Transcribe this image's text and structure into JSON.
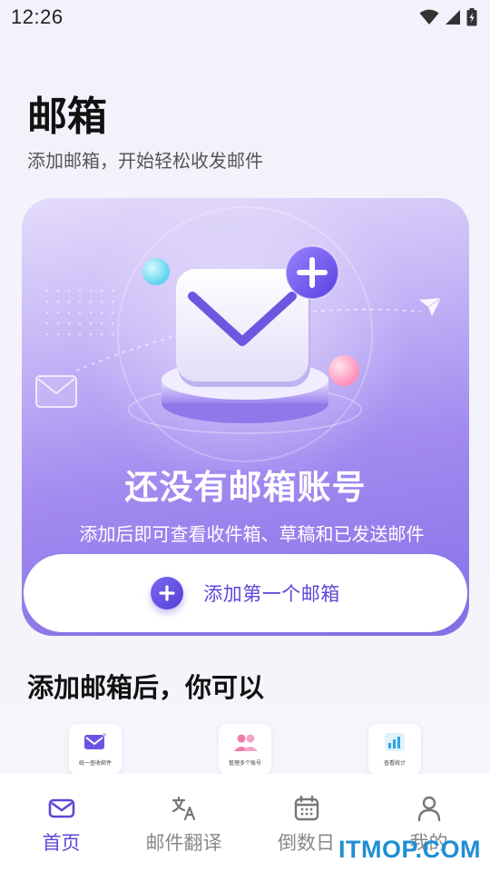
{
  "status_bar": {
    "time": "12:26",
    "icons": [
      "wifi-icon",
      "signal-icon",
      "battery-icon"
    ]
  },
  "page": {
    "title": "邮箱",
    "subtitle": "添加邮箱，开始轻松收发邮件"
  },
  "hero": {
    "heading": "还没有邮箱账号",
    "description": "添加后即可查看收件箱、草稿和已发送邮件",
    "add_button_label": "添加第一个邮箱"
  },
  "features": {
    "title": "添加邮箱后，你可以",
    "items": [
      {
        "label": "统一查收邮件",
        "icon": "envelope-icon"
      },
      {
        "label": "管理多个账号",
        "icon": "users-icon"
      },
      {
        "label": "查看统计",
        "icon": "bar-chart-icon"
      }
    ]
  },
  "tab_bar": {
    "items": [
      {
        "label": "首页",
        "icon": "mail-icon",
        "active": true
      },
      {
        "label": "邮件翻译",
        "icon": "translate-icon",
        "active": false
      },
      {
        "label": "倒数日",
        "icon": "calendar-icon",
        "active": false
      },
      {
        "label": "我的",
        "icon": "person-icon",
        "active": false
      }
    ]
  },
  "watermark": "ITMOP.COM",
  "colors": {
    "accent": "#5a48d8",
    "tab_inactive": "#888888",
    "watermark": "#1f8fd6"
  }
}
